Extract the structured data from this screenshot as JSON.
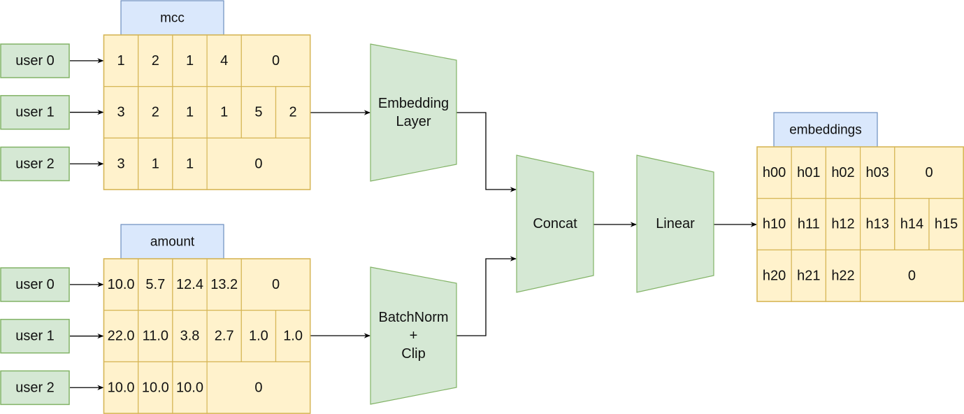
{
  "tables": {
    "mcc": {
      "title": "mcc",
      "users": [
        "user 0",
        "user 1",
        "user 2"
      ],
      "rows": [
        [
          "1",
          "2",
          "1",
          "4",
          "0"
        ],
        [
          "3",
          "2",
          "1",
          "1",
          "5",
          "2"
        ],
        [
          "3",
          "1",
          "1",
          "0"
        ]
      ]
    },
    "amount": {
      "title": "amount",
      "users": [
        "user 0",
        "user 1",
        "user 2"
      ],
      "rows": [
        [
          "10.0",
          "5.7",
          "12.4",
          "13.2",
          "0"
        ],
        [
          "22.0",
          "11.0",
          "3.8",
          "2.7",
          "1.0",
          "1.0"
        ],
        [
          "10.0",
          "10.0",
          "10.0",
          "0"
        ]
      ]
    },
    "embeddings": {
      "title": "embeddings",
      "rows": [
        [
          "h00",
          "h01",
          "h02",
          "h03",
          "0"
        ],
        [
          "h10",
          "h11",
          "h12",
          "h13",
          "h14",
          "h15"
        ],
        [
          "h20",
          "h21",
          "h22",
          "0"
        ]
      ]
    }
  },
  "layers": {
    "embedding": [
      "Embedding",
      "Layer"
    ],
    "batchnorm": [
      "BatchNorm",
      "+",
      "Clip"
    ],
    "concat": [
      "Concat"
    ],
    "linear": [
      "Linear"
    ]
  },
  "colors": {
    "cell_fill": "#fff2cc",
    "cell_stroke": "#d6b656",
    "header_fill": "#dae8fc",
    "header_stroke": "#6c8ebf",
    "node_fill": "#d5e8d4",
    "node_stroke": "#82b366"
  }
}
